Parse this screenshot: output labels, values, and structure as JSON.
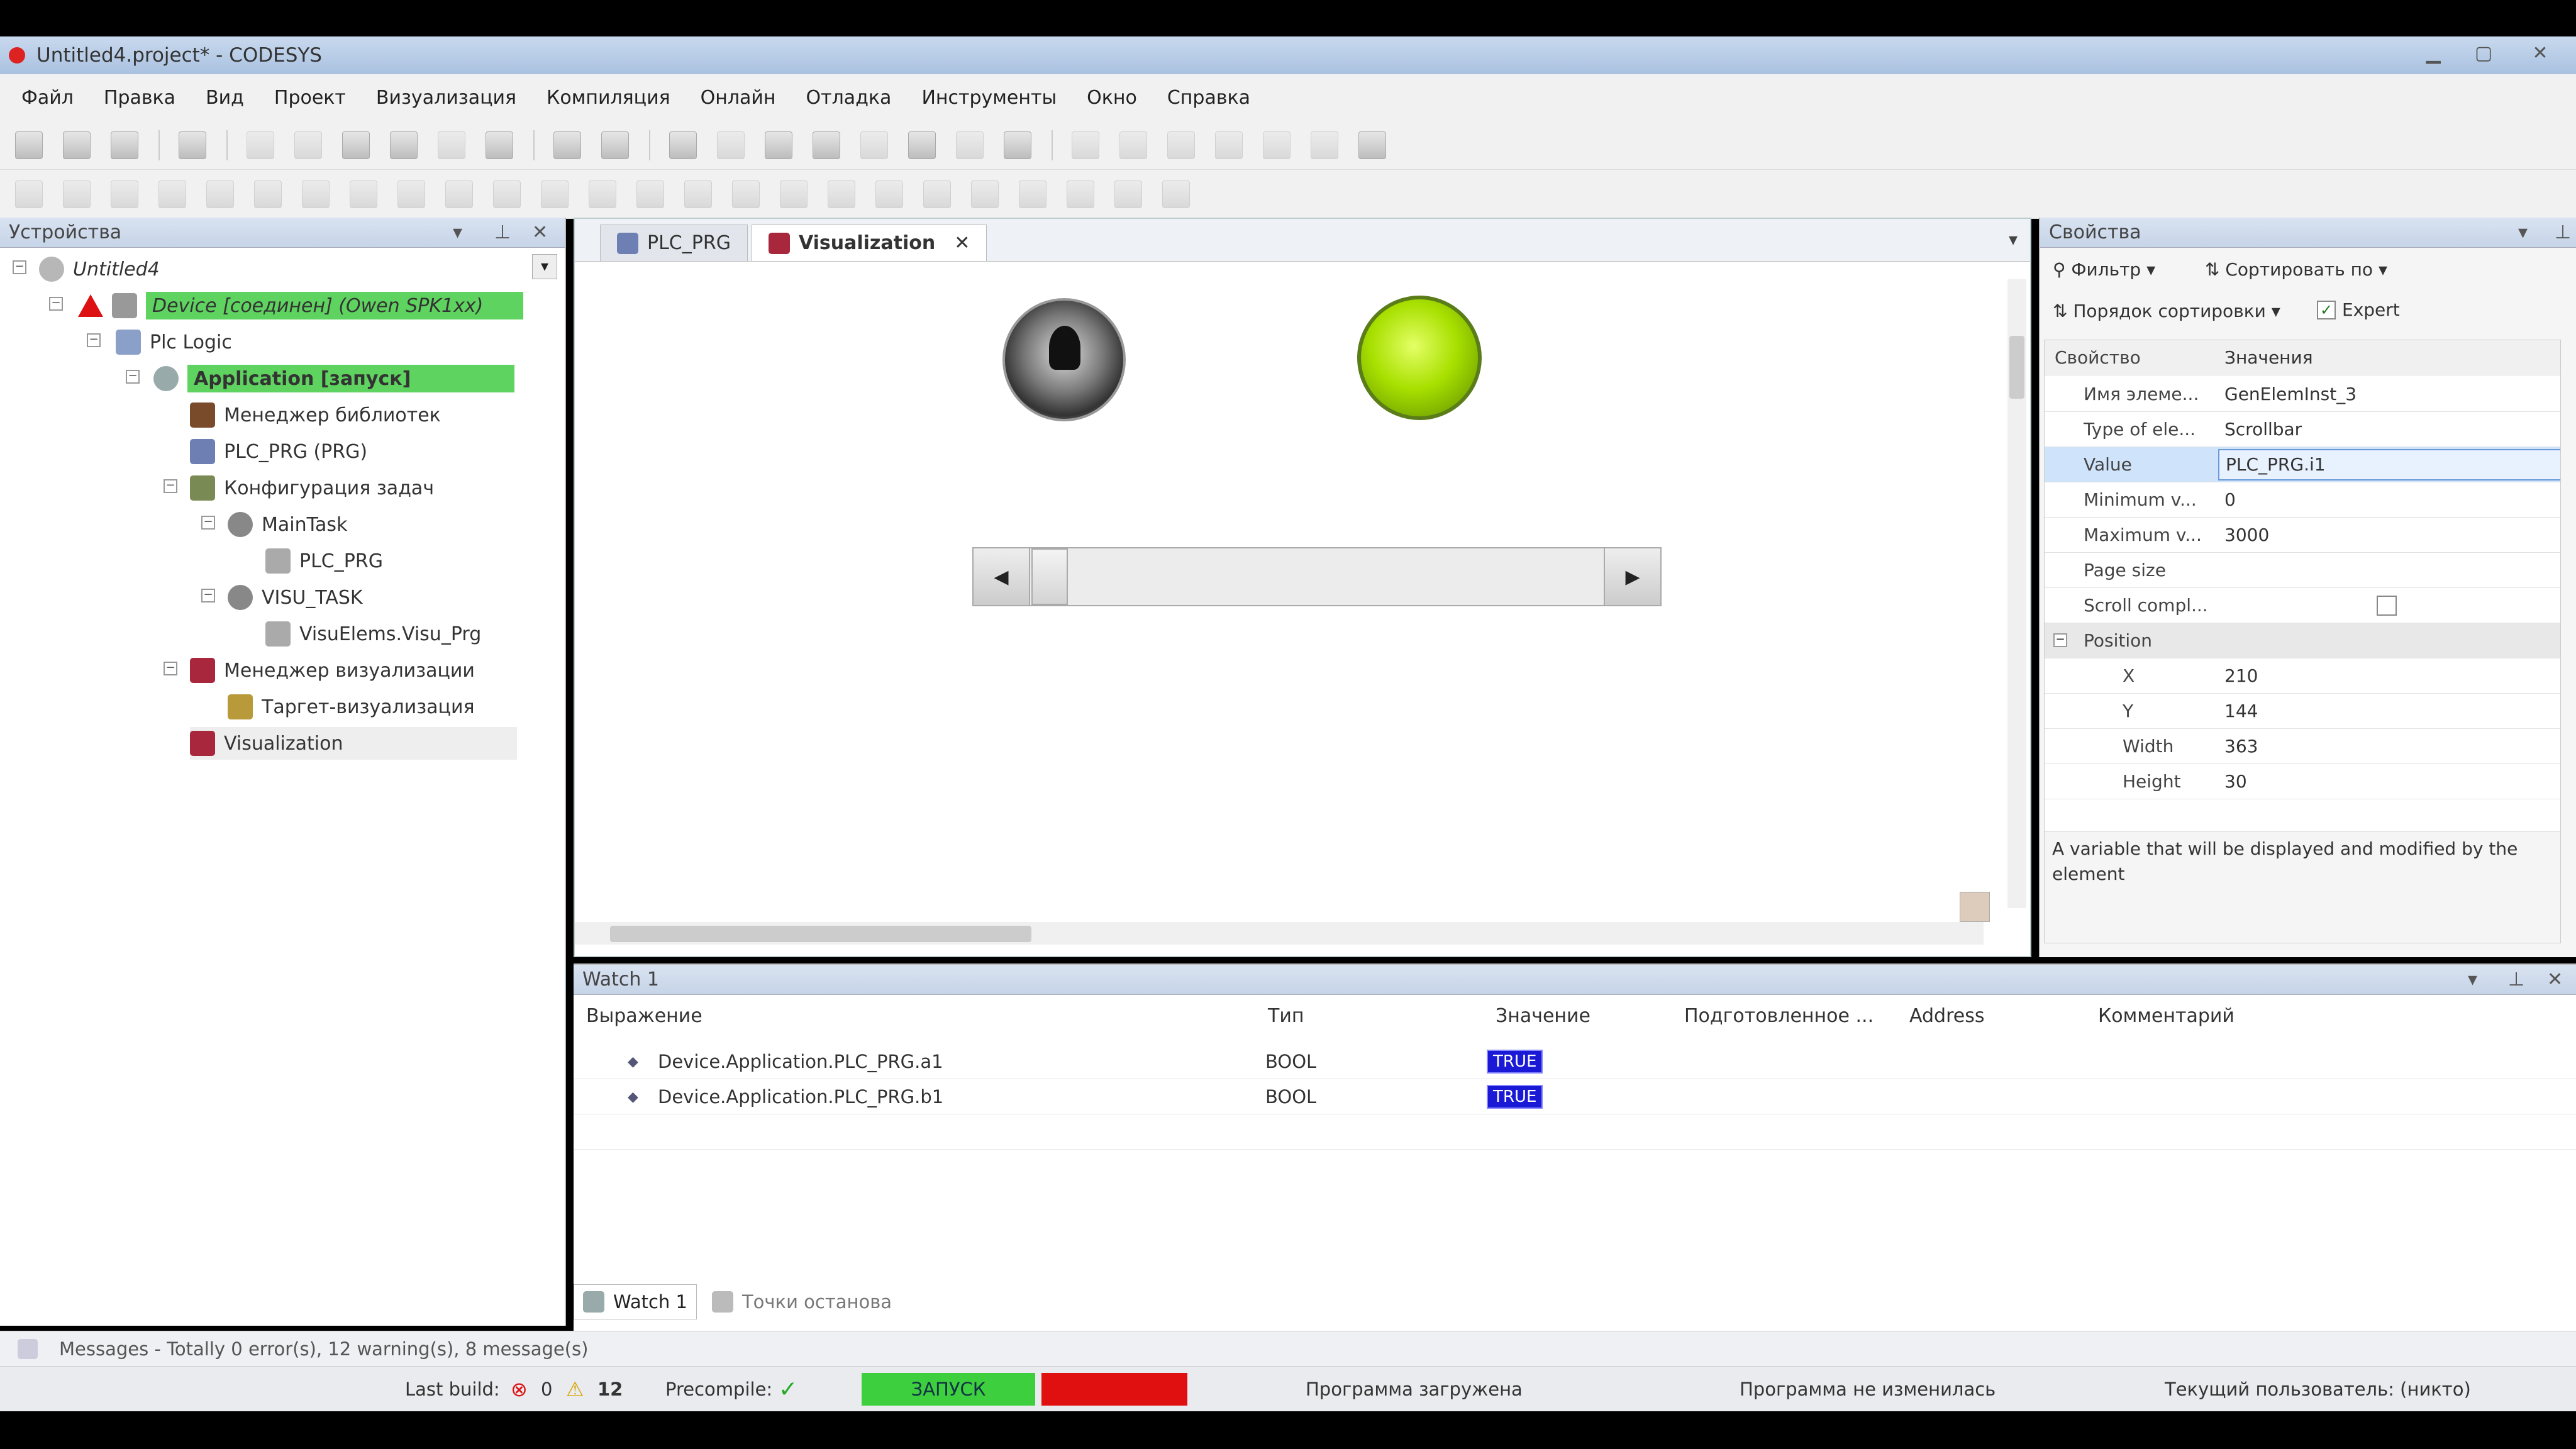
{
  "window": {
    "title": "Untitled4.project* - CODESYS"
  },
  "menu": [
    "Файл",
    "Правка",
    "Вид",
    "Проект",
    "Визуализация",
    "Компиляция",
    "Онлайн",
    "Отладка",
    "Инструменты",
    "Окно",
    "Справка"
  ],
  "devices_panel": {
    "title": "Устройства",
    "tree": [
      {
        "label": "Untitled4",
        "level": 0
      },
      {
        "label": "Device [соединен] (Owen SPK1xx)",
        "level": 1,
        "highlight": true
      },
      {
        "label": "Plc Logic",
        "level": 2
      },
      {
        "label": "Application [запуск]",
        "level": 3,
        "highlight": true
      },
      {
        "label": "Менеджер библиотек",
        "level": 4
      },
      {
        "label": "PLC_PRG (PRG)",
        "level": 4
      },
      {
        "label": "Конфигурация задач",
        "level": 4
      },
      {
        "label": "MainTask",
        "level": 5
      },
      {
        "label": "PLC_PRG",
        "level": 6
      },
      {
        "label": "VISU_TASK",
        "level": 5
      },
      {
        "label": "VisuElems.Visu_Prg",
        "level": 6
      },
      {
        "label": "Менеджер визуализации",
        "level": 4
      },
      {
        "label": "Таргет-визуализация",
        "level": 5
      },
      {
        "label": "Visualization",
        "level": 4
      }
    ]
  },
  "editor": {
    "tabs": [
      {
        "label": "PLC_PRG",
        "active": false
      },
      {
        "label": "Visualization",
        "active": true
      }
    ],
    "close_glyph": "✕"
  },
  "properties": {
    "title": "Свойства",
    "filter_label": "Фильтр",
    "sort_by_label": "Сортировать по",
    "sort_order_label": "Порядок сортировки",
    "expert_label": "Expert",
    "col_property": "Свойство",
    "col_value": "Значения",
    "rows": [
      {
        "key": "Имя элеме...",
        "value": "GenElemInst_3"
      },
      {
        "key": "Type of ele...",
        "value": "Scrollbar"
      },
      {
        "key": "Value",
        "value": "PLC_PRG.i1"
      },
      {
        "key": "Minimum v...",
        "value": "0"
      },
      {
        "key": "Maximum v...",
        "value": "3000"
      },
      {
        "key": "Page size",
        "value": ""
      },
      {
        "key": "Scroll compl...",
        "value": ""
      },
      {
        "key": "Position",
        "value": ""
      },
      {
        "key": "X",
        "value": "210"
      },
      {
        "key": "Y",
        "value": "144"
      },
      {
        "key": "Width",
        "value": "363"
      },
      {
        "key": "Height",
        "value": "30"
      }
    ],
    "description": "A variable that will be displayed and modified by the element"
  },
  "watch": {
    "title": "Watch 1",
    "columns": [
      "Выражение",
      "Тип",
      "Значение",
      "Подготовленное ...",
      "Address",
      "Комментарий"
    ],
    "rows": [
      {
        "expression": "Device.Application.PLC_PRG.a1",
        "type": "BOOL",
        "value": "TRUE"
      },
      {
        "expression": "Device.Application.PLC_PRG.b1",
        "type": "BOOL",
        "value": "TRUE"
      }
    ]
  },
  "bottom_tabs": [
    "Watch 1",
    "Точки останова"
  ],
  "messages": {
    "text": "Messages - Totally 0 error(s), 12 warning(s), 8 message(s)"
  },
  "status": {
    "last_build_label": "Last build:",
    "errors": "0",
    "warnings": "12",
    "precompile_label": "Precompile:",
    "run_state": "ЗАПУСК",
    "program_loaded": "Программа загружена",
    "program_unchanged": "Программа не изменилась",
    "current_user": "Текущий пользователь: (никто)"
  },
  "colors": {
    "highlight_green": "#5fd35f",
    "run_green": "#3ecf3e",
    "stop_red": "#e01010",
    "true_blue": "#1a1ad6",
    "lamp": "#a8e000"
  }
}
